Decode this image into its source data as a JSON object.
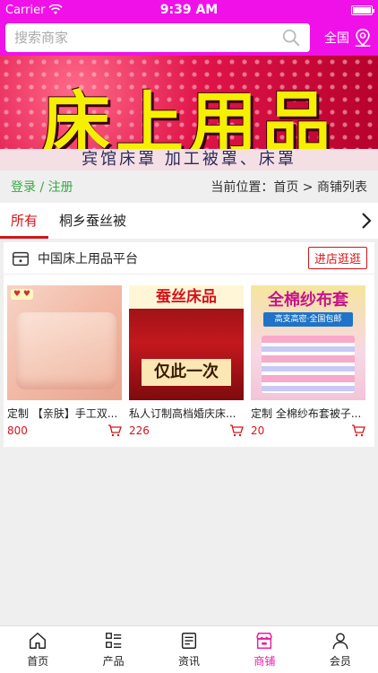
{
  "status": {
    "carrier": "Carrier",
    "time": "9:39 AM"
  },
  "search": {
    "placeholder": "搜索商家",
    "region_label": "全国"
  },
  "banner": {
    "title": "床上用品",
    "subtitle": "宾馆床罩 加工被罩、床罩"
  },
  "nav_row": {
    "login": "登录 / 注册",
    "location": "当前位置：首页 > 商铺列表"
  },
  "tabs": [
    {
      "label": "所有",
      "active": true
    },
    {
      "label": "桐乡蚕丝被",
      "active": false
    }
  ],
  "store": {
    "name": "中国床上用品平台",
    "enter_label": "进店逛逛",
    "products": [
      {
        "title": "定制 【亲肤】手工双...",
        "price": "800",
        "image_text": ""
      },
      {
        "title": "私人订制高档婚庆床...",
        "price": "226",
        "image_text": "蚕丝床品",
        "image_text2": "仅此一次"
      },
      {
        "title": "定制 全棉纱布套被子...",
        "price": "20",
        "image_text": "全棉纱布套",
        "image_text2": "高支高密·全国包邮"
      }
    ]
  },
  "bottom_nav": [
    {
      "label": "首页",
      "icon": "home-icon",
      "active": false
    },
    {
      "label": "产品",
      "icon": "grid-list-icon",
      "active": false
    },
    {
      "label": "资讯",
      "icon": "news-icon",
      "active": false
    },
    {
      "label": "商铺",
      "icon": "shop-icon",
      "active": true
    },
    {
      "label": "会员",
      "icon": "person-icon",
      "active": false
    }
  ],
  "colors": {
    "header": "#f011e8",
    "accent_red": "#d4141a",
    "login_green": "#39a845",
    "nav_active": "#e91ea3"
  }
}
